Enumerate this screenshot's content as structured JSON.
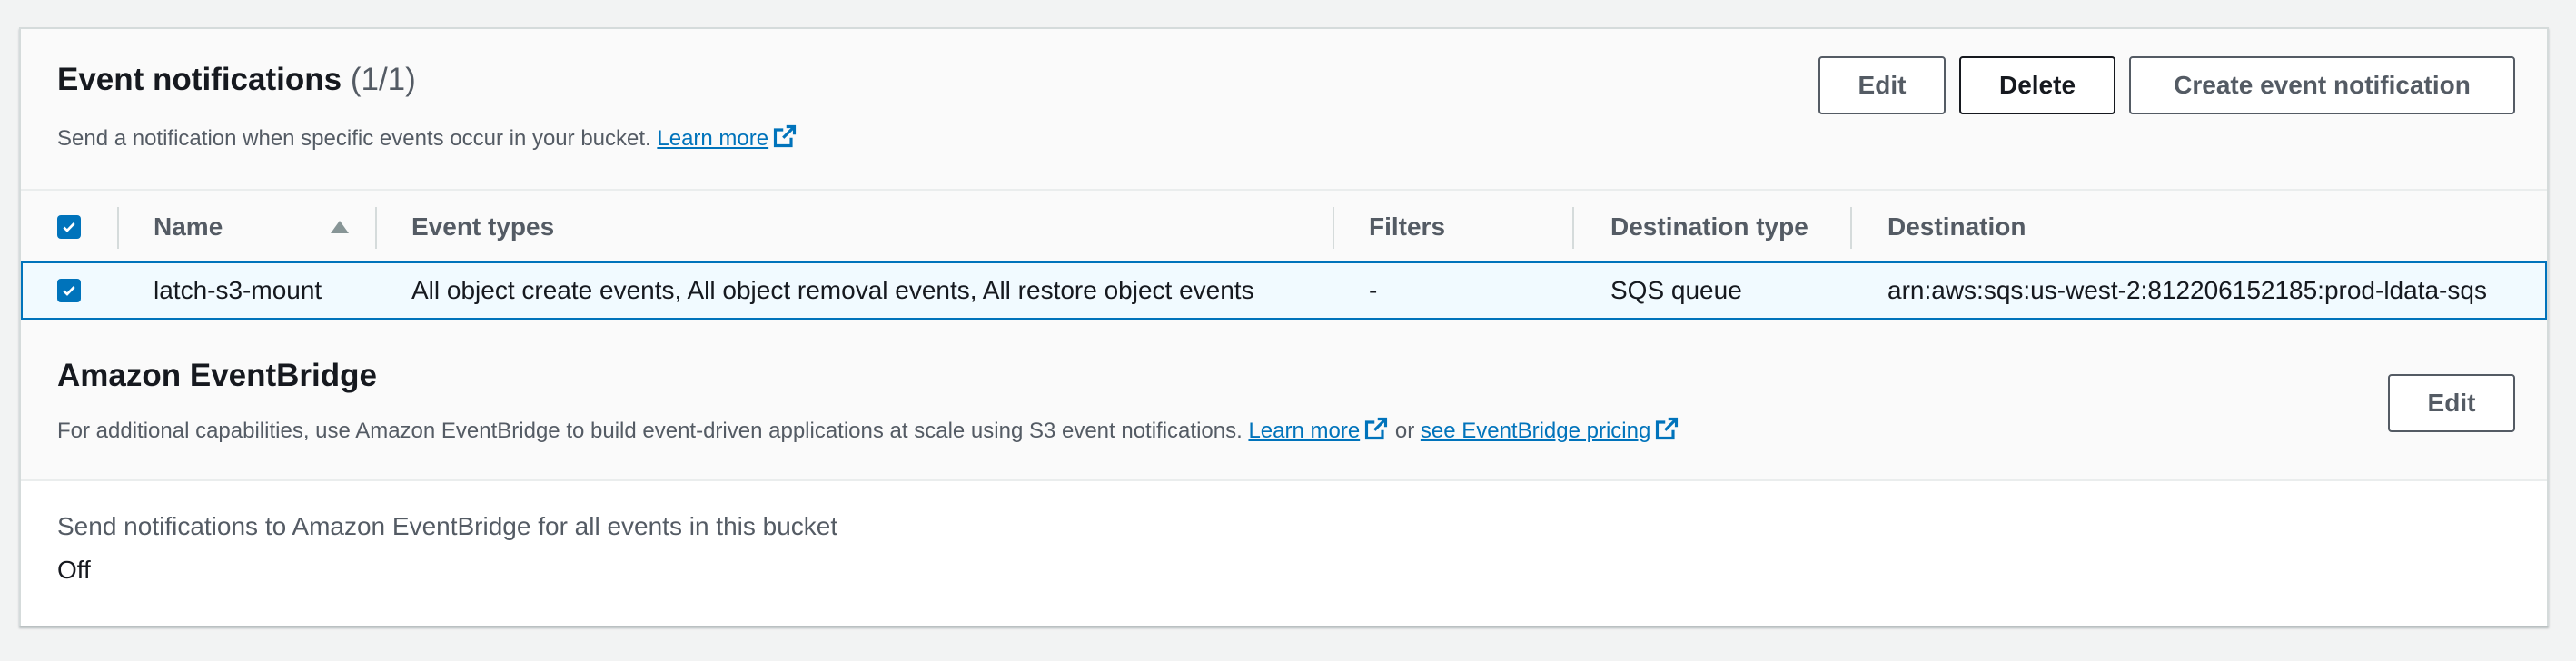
{
  "event_notifications": {
    "title": "Event notifications",
    "count": "(1/1)",
    "description": "Send a notification when specific events occur in your bucket.",
    "learn_more": "Learn more",
    "buttons": {
      "edit": "Edit",
      "delete": "Delete",
      "create": "Create event notification"
    },
    "columns": {
      "name": "Name",
      "event_types": "Event types",
      "filters": "Filters",
      "destination_type": "Destination type",
      "destination": "Destination"
    },
    "rows": [
      {
        "selected": true,
        "name": "latch-s3-mount",
        "event_types": "All object create events, All object removal events, All restore object events",
        "filters": "-",
        "destination_type": "SQS queue",
        "destination": "arn:aws:sqs:us-west-2:812206152185:prod-ldata-sqs"
      }
    ],
    "sort_indicator": "ascending"
  },
  "eventbridge": {
    "title": "Amazon EventBridge",
    "description": "For additional capabilities, use Amazon EventBridge to build event-driven applications at scale using S3 event notifications.",
    "learn_more": "Learn more",
    "or": "or",
    "pricing_link": "see EventBridge pricing",
    "edit": "Edit",
    "setting_label": "Send notifications to Amazon EventBridge for all events in this bucket",
    "setting_value": "Off"
  },
  "colors": {
    "accent": "#0073bb",
    "selected_row_bg": "#f1faff",
    "text_primary": "#16191f",
    "text_secondary": "#545b64"
  }
}
